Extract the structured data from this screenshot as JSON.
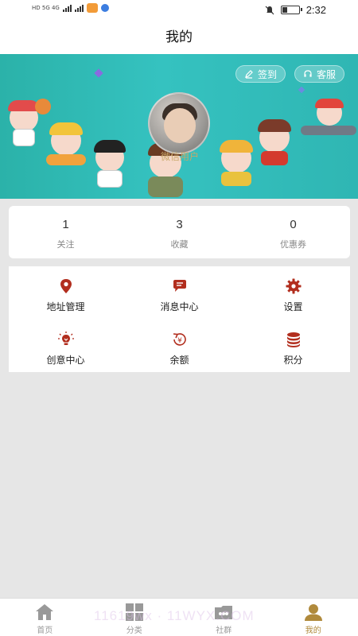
{
  "status_bar": {
    "left_text": "HD 5G 4G",
    "time": "2:32",
    "battery_percent": 30
  },
  "header": {
    "title": "我的"
  },
  "banner": {
    "checkin_label": "签到",
    "service_label": "客服",
    "username": "微信用户"
  },
  "stats": [
    {
      "value": "1",
      "label": "关注"
    },
    {
      "value": "3",
      "label": "收藏"
    },
    {
      "value": "0",
      "label": "优惠券"
    }
  ],
  "menu": [
    {
      "label": "地址管理",
      "icon": "location-pin-icon"
    },
    {
      "label": "消息中心",
      "icon": "message-bubble-icon"
    },
    {
      "label": "设置",
      "icon": "gear-icon"
    },
    {
      "label": "创意中心",
      "icon": "lightbulb-icon"
    },
    {
      "label": "余额",
      "icon": "yen-coin-icon"
    },
    {
      "label": "积分",
      "icon": "coin-stack-icon"
    }
  ],
  "tabs": [
    {
      "label": "首页",
      "icon": "home-icon",
      "active": false
    },
    {
      "label": "分类",
      "icon": "grid-icon",
      "active": false
    },
    {
      "label": "社群",
      "icon": "community-icon",
      "active": false
    },
    {
      "label": "我的",
      "icon": "user-icon",
      "active": true
    }
  ],
  "watermark": "11619wx · 11WYX.COM",
  "colors": {
    "accent": "#b22e1e",
    "banner": "#2fb6b3",
    "active_tab": "#b08a3c"
  }
}
